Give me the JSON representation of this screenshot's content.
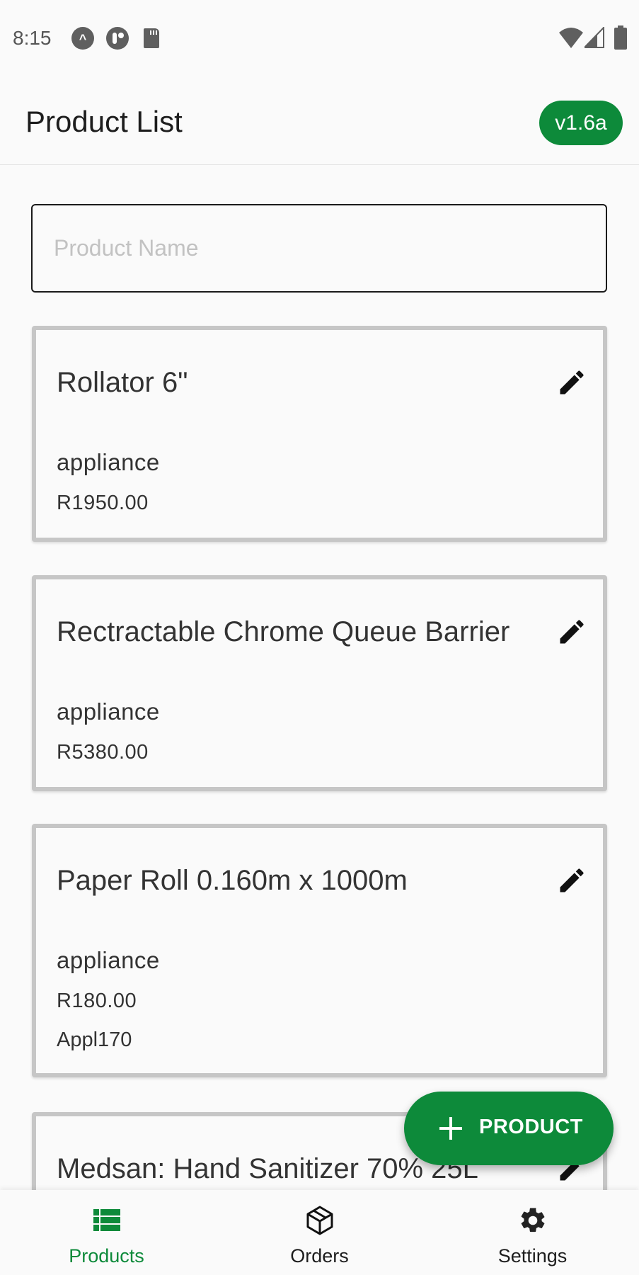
{
  "status_bar": {
    "time": "8:15",
    "left_icons": [
      "app-launcher-icon",
      "notification-app-icon",
      "sd-card-icon"
    ],
    "right_icons": [
      "wifi-icon",
      "cellular-signal-icon",
      "battery-icon"
    ]
  },
  "header": {
    "title": "Product List",
    "version": "v1.6a"
  },
  "search": {
    "value": "",
    "placeholder": "Product Name"
  },
  "products": [
    {
      "name": "Rollator 6\"",
      "category": "appliance",
      "price": "R1950.00",
      "code": ""
    },
    {
      "name": "Rectractable Chrome Queue Barrier",
      "category": "appliance",
      "price": "R5380.00",
      "code": ""
    },
    {
      "name": "Paper Roll 0.160m x 1000m",
      "category": "appliance",
      "price": "R180.00",
      "code": "Appl170"
    },
    {
      "name": "Medsan: Hand Sanitizer 70% 25L",
      "category": "",
      "price": "",
      "code": ""
    }
  ],
  "fab": {
    "icon": "plus-icon",
    "label": "PRODUCT"
  },
  "bottom_nav": {
    "items": [
      {
        "label": "Products",
        "icon": "list-icon",
        "active": true
      },
      {
        "label": "Orders",
        "icon": "box-icon",
        "active": false
      },
      {
        "label": "Settings",
        "icon": "gear-icon",
        "active": false
      }
    ]
  },
  "colors": {
    "accent": "#0d8a3a",
    "background": "#fafafa",
    "card_border": "#c6c6c6"
  }
}
